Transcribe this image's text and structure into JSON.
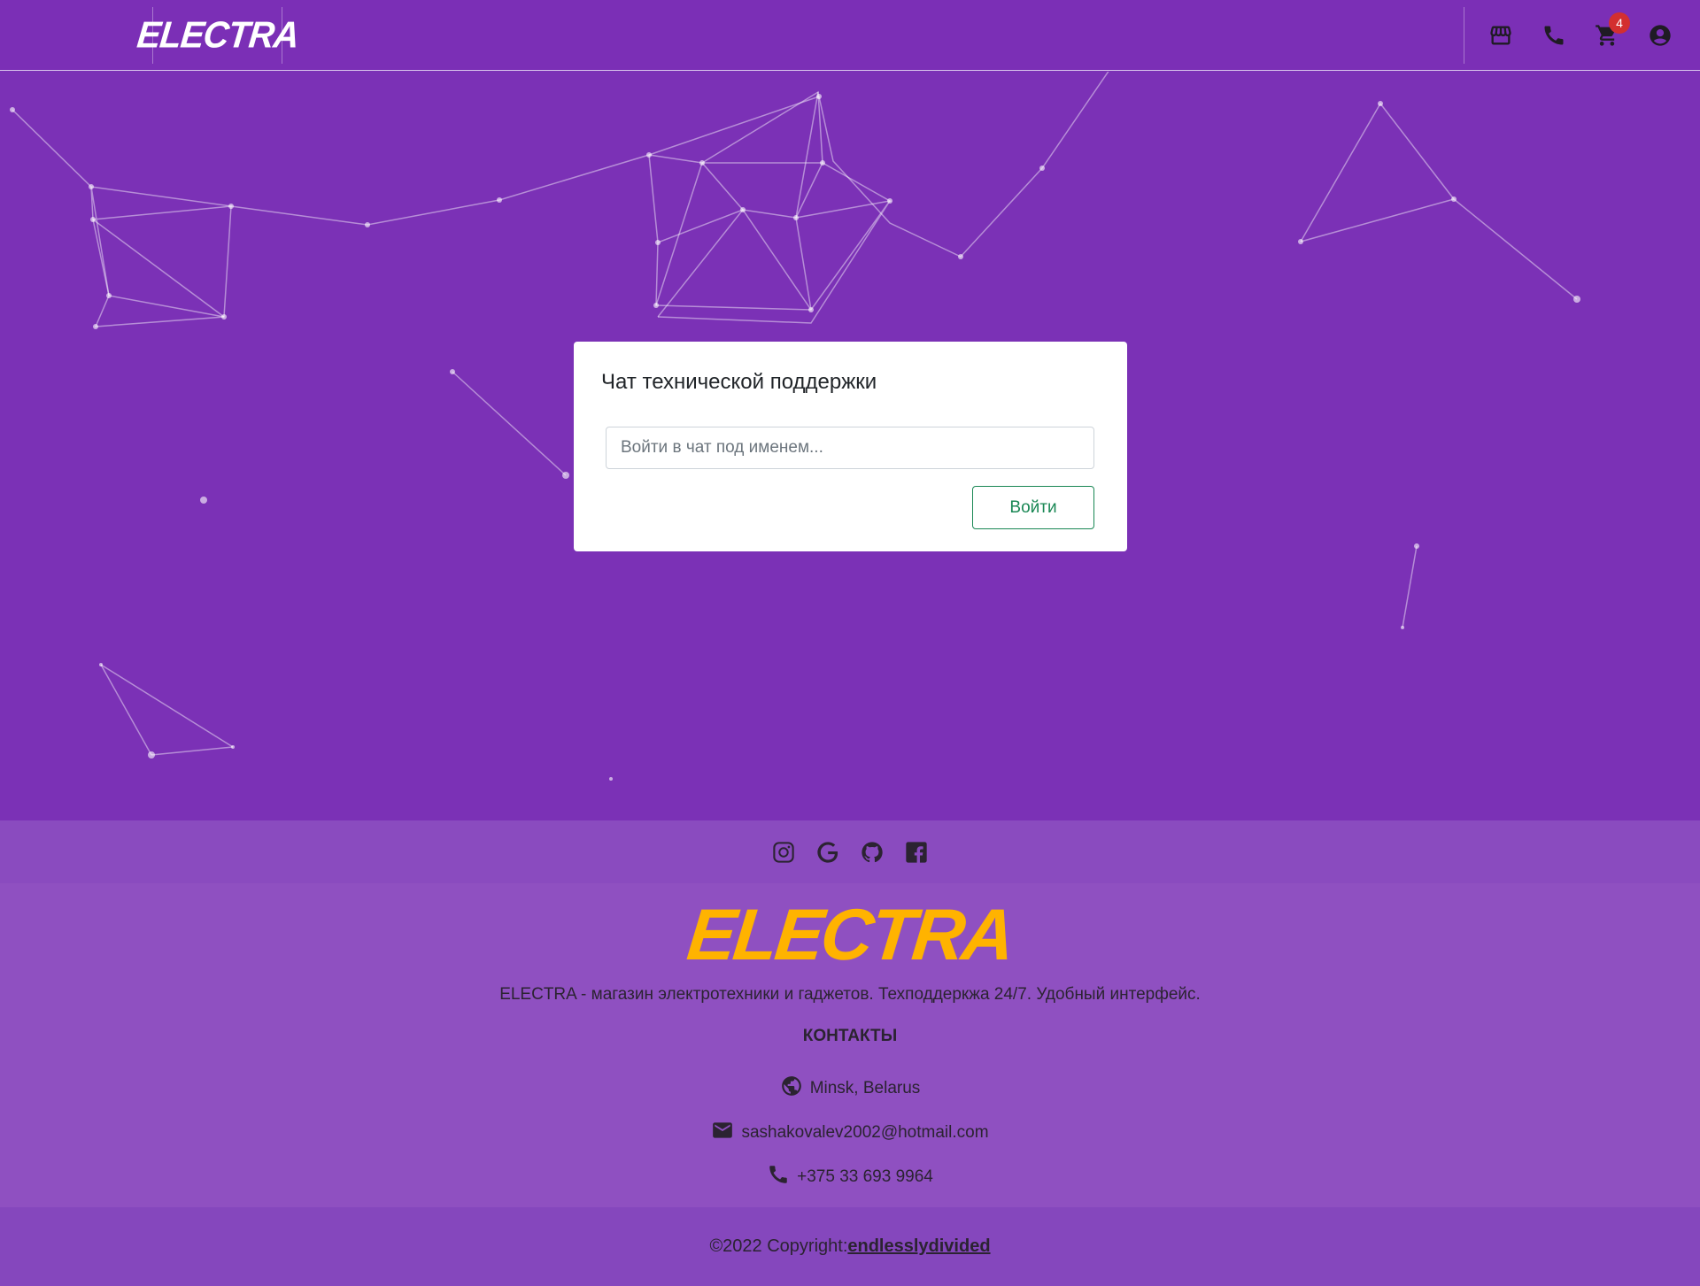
{
  "header": {
    "logo": "ELECTRA",
    "cart_count": "4",
    "icons": [
      "store-icon",
      "phone-icon",
      "cart-icon",
      "account-icon"
    ]
  },
  "modal": {
    "title": "Чат технической поддержки",
    "input_placeholder": "Войти в чат под именем...",
    "input_value": "",
    "submit_label": "Войти"
  },
  "footer": {
    "social_icons": [
      "instagram-icon",
      "google-icon",
      "github-icon",
      "facebook-icon"
    ],
    "logo": "ELECTRA",
    "description": "ELECTRA - магазин электротехники и гаджетов. Техподдеркжа 24/7. Удобный интерфейс.",
    "contacts_heading": "КОНТАКТЫ",
    "location": "Minsk, Belarus",
    "email": "sashakovalev2002@hotmail.com",
    "phone": "+375 33 693 9964",
    "copyright_prefix": "©2022 Copyright:",
    "copyright_link": "endlesslydivided"
  },
  "colors": {
    "header_bg": "#7b2fb6",
    "page_bg": "#7b31b6",
    "footer_bg": "#8f50c1",
    "accent_logo": "#ffb300",
    "button_green": "#198754",
    "badge_red": "#d32f2f"
  }
}
